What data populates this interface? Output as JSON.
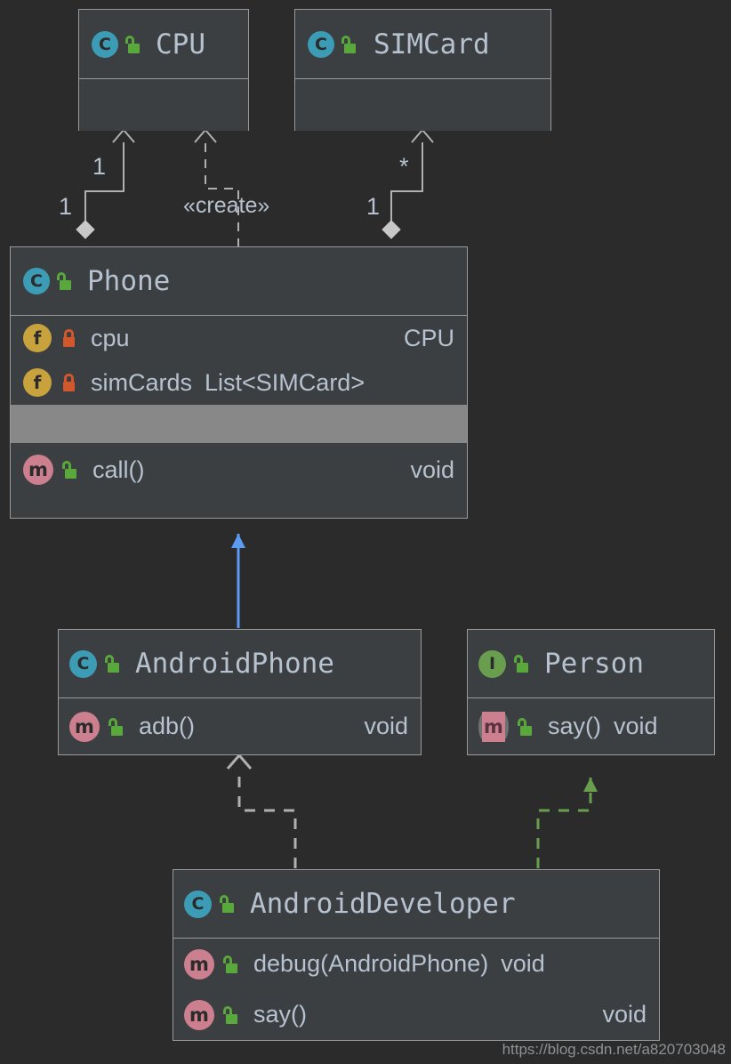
{
  "diagram": {
    "kind": "uml-class-diagram",
    "background_color": "#2b2b2b",
    "box_fill": "#3c3f41",
    "box_border": "#9a9a9a",
    "text_color": "#b6c2cf",
    "separator_color": "#888888",
    "watermark": "https://blog.csdn.net/a820703048"
  },
  "classes": {
    "cpu": {
      "name": "CPU",
      "stereotype_icon": "class-icon",
      "visibility_icon": "unlocked-green-icon",
      "members": []
    },
    "simcard": {
      "name": "SIMCard",
      "stereotype_icon": "class-icon",
      "visibility_icon": "unlocked-green-icon",
      "members": []
    },
    "phone": {
      "name": "Phone",
      "stereotype_icon": "class-icon",
      "visibility_icon": "unlocked-green-icon",
      "fields": [
        {
          "icon": "field-icon",
          "lock": "locked-orange-icon",
          "name": "cpu",
          "type": "CPU"
        },
        {
          "icon": "field-icon",
          "lock": "locked-orange-icon",
          "name": "simCards",
          "type": "List<SIMCard>"
        }
      ],
      "methods": [
        {
          "icon": "method-icon",
          "lock": "unlocked-green-icon",
          "name": "call()",
          "type": "void"
        }
      ]
    },
    "androidphone": {
      "name": "AndroidPhone",
      "stereotype_icon": "class-icon",
      "visibility_icon": "unlocked-green-icon",
      "methods": [
        {
          "icon": "method-icon",
          "lock": "unlocked-green-icon",
          "name": "adb()",
          "type": "void"
        }
      ]
    },
    "person": {
      "name": "Person",
      "stereotype_icon": "interface-icon",
      "visibility_icon": "unlocked-green-icon",
      "methods": [
        {
          "icon": "abstract-method-icon",
          "lock": "unlocked-green-icon",
          "name": "say()",
          "type": "void"
        }
      ]
    },
    "androiddeveloper": {
      "name": "AndroidDeveloper",
      "stereotype_icon": "class-icon",
      "visibility_icon": "unlocked-green-icon",
      "methods": [
        {
          "icon": "method-icon",
          "lock": "unlocked-green-icon",
          "name": "debug(AndroidPhone)",
          "type": "void"
        },
        {
          "icon": "method-icon",
          "lock": "unlocked-green-icon",
          "name": "say()",
          "type": "void"
        }
      ]
    }
  },
  "icon_glyphs": {
    "class": "C",
    "interface": "I",
    "field": "f",
    "method": "m"
  },
  "relations": [
    {
      "id": "phone-cpu-composition",
      "from": "Phone",
      "to": "CPU",
      "type": "composition",
      "source_multiplicity": "1",
      "target_multiplicity": "1",
      "color": "#b0b0b0"
    },
    {
      "id": "phone-cpu-create",
      "from": "Phone",
      "to": "CPU",
      "type": "dependency",
      "stereotype": "«create»",
      "style": "dashed",
      "color": "#b0b0b0"
    },
    {
      "id": "phone-simcard-composition",
      "from": "Phone",
      "to": "SIMCard",
      "type": "composition",
      "source_multiplicity": "1",
      "target_multiplicity": "*",
      "color": "#b0b0b0"
    },
    {
      "id": "androidphone-phone-inheritance",
      "from": "AndroidPhone",
      "to": "Phone",
      "type": "generalization",
      "style": "solid",
      "color": "#5b9bf0"
    },
    {
      "id": "androiddeveloper-androidphone-dependency",
      "from": "AndroidDeveloper",
      "to": "AndroidPhone",
      "type": "dependency",
      "style": "dashed",
      "color": "#b0b0b0"
    },
    {
      "id": "androiddeveloper-person-realization",
      "from": "AndroidDeveloper",
      "to": "Person",
      "type": "realization",
      "style": "dashed",
      "color": "#6a9e4f"
    }
  ],
  "edge_labels": {
    "cpu_target_mult": "1",
    "cpu_source_mult": "1",
    "create_stereotype": "«create»",
    "sim_target_mult": "*",
    "sim_source_mult": "1"
  }
}
